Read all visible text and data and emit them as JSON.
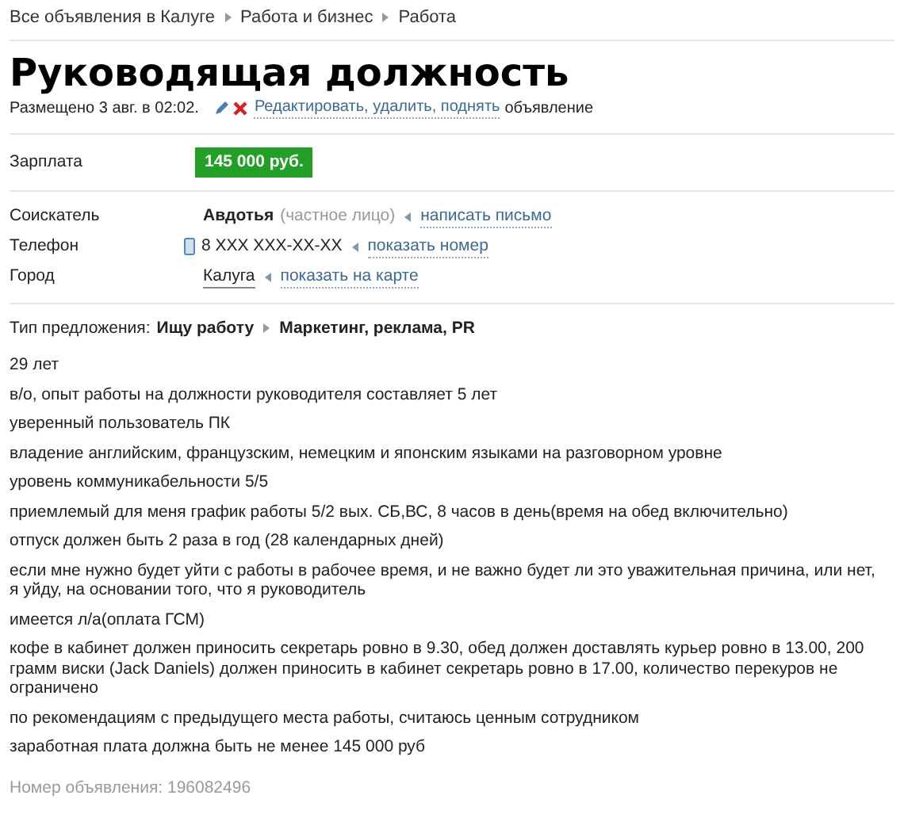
{
  "breadcrumbs": [
    "Все объявления в Калуге",
    "Работа и бизнес",
    "Работа"
  ],
  "title": "Руководящая должность",
  "meta": {
    "posted": "Размещено 3 авг. в 02:02.",
    "actions_link": "Редактировать, удалить, поднять",
    "actions_suffix": "объявление"
  },
  "salary": {
    "label": "Зарплата",
    "value": "145 000 руб."
  },
  "seeker": {
    "label": "Соискатель",
    "name": "Авдотья",
    "note": "(частное лицо)",
    "link": "написать письмо"
  },
  "phone": {
    "label": "Телефон",
    "number": "8 XXX XXX-XX-XX",
    "link": "показать номер"
  },
  "city": {
    "label": "Город",
    "value": "Калуга",
    "link": "показать на карте"
  },
  "offer": {
    "label": "Тип предложения:",
    "category": "Ищу работу",
    "subcategory": "Маркетинг, реклама, PR"
  },
  "paragraphs": [
    "29 лет",
    "в/о, опыт работы на должности руководителя составляет 5 лет",
    "уверенный пользователь ПК",
    "владение английским, французским, немецким и японским языками на разговорном уровне",
    "уровень коммуникабельности 5/5",
    "приемлемый для меня график работы 5/2 вых. СБ,ВС, 8 часов в день(время на обед включительно)",
    "отпуск должен быть 2 раза в год (28 календарных дней)",
    "если мне нужно будет уйти с работы в рабочее время, и не важно будет ли это уважительная причина, или нет, я уйду, на основании того, что я руководитель",
    "имеется л/а(оплата ГСМ)",
    "кофе в кабинет должен приносить секретарь ровно в 9.30, обед должен доставлять курьер ровно в 13.00, 200 грамм виски (Jack Daniels) должен приносить в кабинет секретарь ровно в 17.00, количество перекуров не ограничено",
    "по рекомендациям с предыдущего места работы, считаюсь ценным сотрудником",
    "заработная плата должна быть не менее 145 000 руб"
  ],
  "footer": "Номер объявления: 196082496"
}
